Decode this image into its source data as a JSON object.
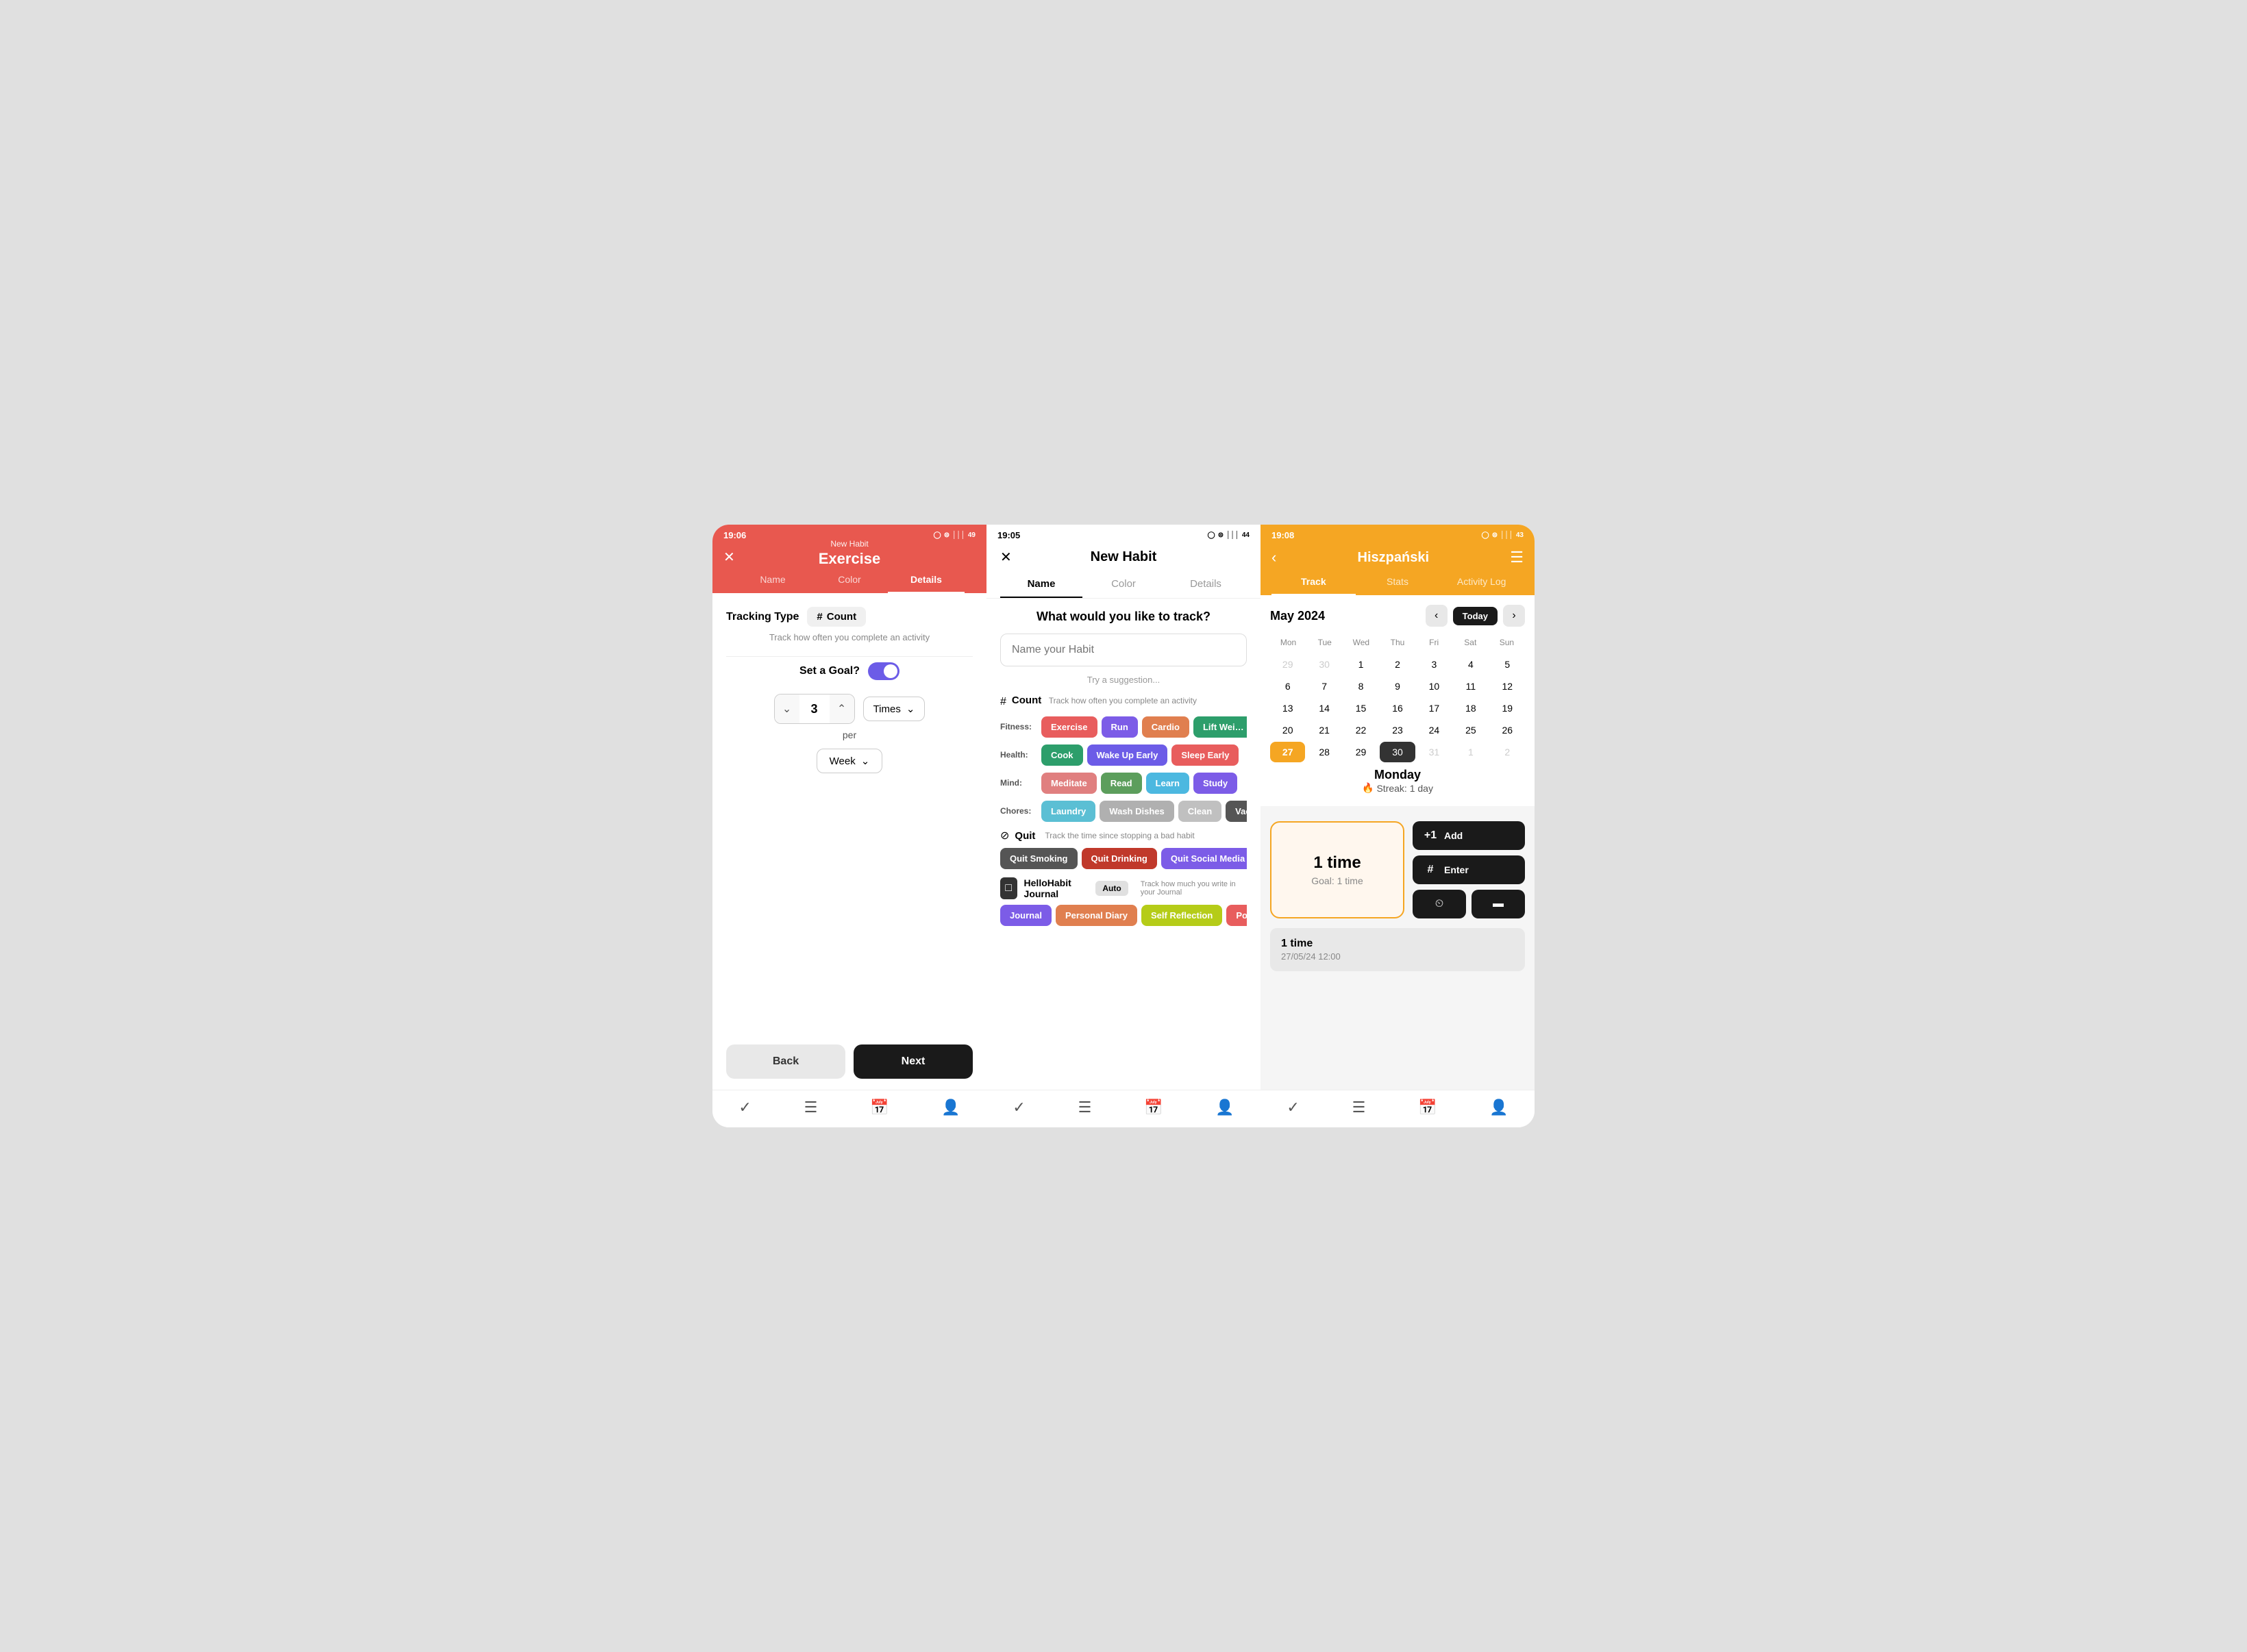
{
  "screen1": {
    "status_time": "19:06",
    "header_subtitle": "New Habit",
    "header_title": "Exercise",
    "tabs": [
      "Name",
      "Color",
      "Details"
    ],
    "active_tab": "Details",
    "tracking_label": "Tracking Type",
    "count_label": "Count",
    "tracking_desc": "Track how often you complete an activity",
    "set_goal_label": "Set a Goal?",
    "goal_value": "3",
    "times_label": "Times",
    "per_label": "per",
    "week_label": "Week",
    "btn_back": "Back",
    "btn_next": "Next",
    "nav": [
      "✓",
      "☰",
      "📅",
      "👤"
    ]
  },
  "screen2": {
    "status_time": "19:05",
    "title": "New Habit",
    "tabs": [
      "Name",
      "Color",
      "Details"
    ],
    "active_tab": "Name",
    "what_track": "What would you like to track?",
    "input_placeholder": "Name your Habit",
    "try_suggestion": "Try a suggestion...",
    "count_label": "Count",
    "count_desc": "Track how often you complete an activity",
    "fitness_label": "Fitness:",
    "fitness_tags": [
      "Exercise",
      "Run",
      "Cardio",
      "Lift Wei…"
    ],
    "health_label": "Health:",
    "health_tags": [
      "Cook",
      "Wake Up Early",
      "Sleep Early"
    ],
    "mind_label": "Mind:",
    "mind_tags": [
      "Meditate",
      "Read",
      "Learn",
      "Study"
    ],
    "chores_label": "Chores:",
    "chores_tags": [
      "Laundry",
      "Wash Dishes",
      "Clean",
      "Vac…"
    ],
    "quit_label": "Quit",
    "quit_desc": "Track the time since stopping a bad habit",
    "quit_tags": [
      "Quit Smoking",
      "Quit Drinking",
      "Quit Social Media"
    ],
    "journal_label": "HelloHabit Journal",
    "journal_auto": "Auto",
    "journal_desc": "Track how much you write in your Journal",
    "journal_tags": [
      "Journal",
      "Personal Diary",
      "Self Reflection",
      "Po…"
    ],
    "nav": [
      "✓",
      "☰",
      "📅",
      "👤"
    ]
  },
  "screen3": {
    "status_time": "19:08",
    "title": "Hiszpański",
    "tabs": [
      "Track",
      "Stats",
      "Activity Log"
    ],
    "active_tab": "Track",
    "month": "May 2024",
    "today_btn": "Today",
    "day_labels": [
      "Mon",
      "Tue",
      "Wed",
      "Thu",
      "Fri",
      "Sat",
      "Sun"
    ],
    "calendar_rows": [
      [
        {
          "d": "29",
          "other": true
        },
        {
          "d": "30",
          "other": true
        },
        {
          "d": "1"
        },
        {
          "d": "2"
        },
        {
          "d": "3"
        },
        {
          "d": "4"
        },
        {
          "d": "5"
        }
      ],
      [
        {
          "d": "6"
        },
        {
          "d": "7"
        },
        {
          "d": "8"
        },
        {
          "d": "9"
        },
        {
          "d": "10"
        },
        {
          "d": "11"
        },
        {
          "d": "12"
        }
      ],
      [
        {
          "d": "13"
        },
        {
          "d": "14"
        },
        {
          "d": "15"
        },
        {
          "d": "16"
        },
        {
          "d": "17"
        },
        {
          "d": "18"
        },
        {
          "d": "19"
        }
      ],
      [
        {
          "d": "20"
        },
        {
          "d": "21"
        },
        {
          "d": "22"
        },
        {
          "d": "23"
        },
        {
          "d": "24"
        },
        {
          "d": "25"
        },
        {
          "d": "26"
        }
      ],
      [
        {
          "d": "27",
          "today": true
        },
        {
          "d": "28"
        },
        {
          "d": "29"
        },
        {
          "d": "30",
          "selected": true
        },
        {
          "d": "31",
          "other_end": true
        },
        {
          "d": "1",
          "other": true
        },
        {
          "d": "2",
          "other": true
        }
      ]
    ],
    "streak_day": "Monday",
    "streak_label": "Streak: 1 day",
    "track_count": "1 time",
    "track_goal": "Goal: 1 time",
    "btn_add": "+1  Add",
    "btn_enter": "#  Enter",
    "history_count": "1 time",
    "history_time": "27/05/24 12:00",
    "nav": [
      "✓",
      "☰",
      "📅",
      "👤"
    ]
  }
}
